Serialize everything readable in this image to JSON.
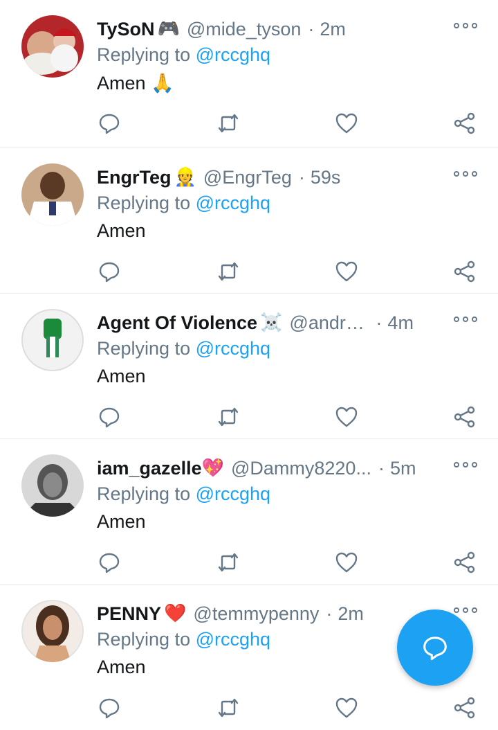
{
  "tweets": [
    {
      "name": "TySoN",
      "emoji": "🎮",
      "handle": "@mide_tyson",
      "time": "2m",
      "replying_prefix": "Replying to ",
      "replying_handle": "@rccghq",
      "text": "Amen 🙏"
    },
    {
      "name": "EngrTeg",
      "emoji": "👷",
      "handle": "@EngrTeg",
      "time": "59s",
      "replying_prefix": "Replying to ",
      "replying_handle": "@rccghq",
      "text": "Amen"
    },
    {
      "name": "Agent Of Violence",
      "emoji": "☠️",
      "handle": "@andre...",
      "time": "4m",
      "replying_prefix": "Replying to ",
      "replying_handle": "@rccghq",
      "text": "Amen"
    },
    {
      "name": "iam_gazelle",
      "emoji": "💖",
      "handle": "@Dammy8220...",
      "time": "5m",
      "replying_prefix": "Replying to ",
      "replying_handle": "@rccghq",
      "text": "Amen"
    },
    {
      "name": "PENNY",
      "emoji": "❤️",
      "handle": "@temmypenny",
      "time": "2m",
      "replying_prefix": "Replying to ",
      "replying_handle": "@rccghq",
      "text": "Amen"
    }
  ],
  "icons": {
    "reply": "reply-icon",
    "retweet": "retweet-icon",
    "like": "heart-icon",
    "share": "share-icon",
    "more": "more-options-icon",
    "compose": "compose-reply-icon"
  },
  "colors": {
    "accent": "#1da1f2",
    "secondary_text": "#657786",
    "primary_text": "#14171a",
    "divider": "#e6ecf0"
  }
}
